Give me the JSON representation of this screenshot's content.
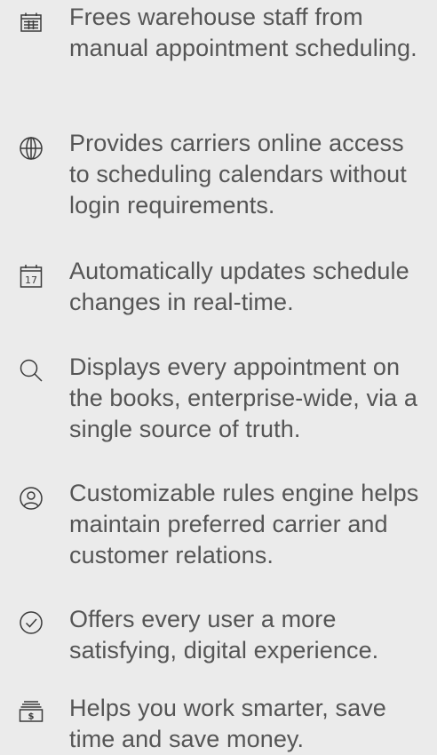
{
  "features": [
    {
      "icon": "calendar-grid-icon",
      "text": "Frees warehouse staff from manual appointment scheduling."
    },
    {
      "icon": "globe-icon",
      "text": "Provides carriers online access to scheduling calendars without login requirements."
    },
    {
      "icon": "calendar-17-icon",
      "icon_label": "17",
      "text": "Automatically updates schedule changes in real-time."
    },
    {
      "icon": "search-icon",
      "text": "Displays every appointment on the books, enterprise-wide, via a single source of truth."
    },
    {
      "icon": "user-circle-icon",
      "text": "Customizable rules engine helps maintain preferred carrier and customer relations."
    },
    {
      "icon": "check-circle-icon",
      "text": "Offers every user a more satisfying, digital experience."
    },
    {
      "icon": "money-stack-icon",
      "icon_label": "$",
      "text": "Helps you work smarter, save time and save money."
    }
  ]
}
